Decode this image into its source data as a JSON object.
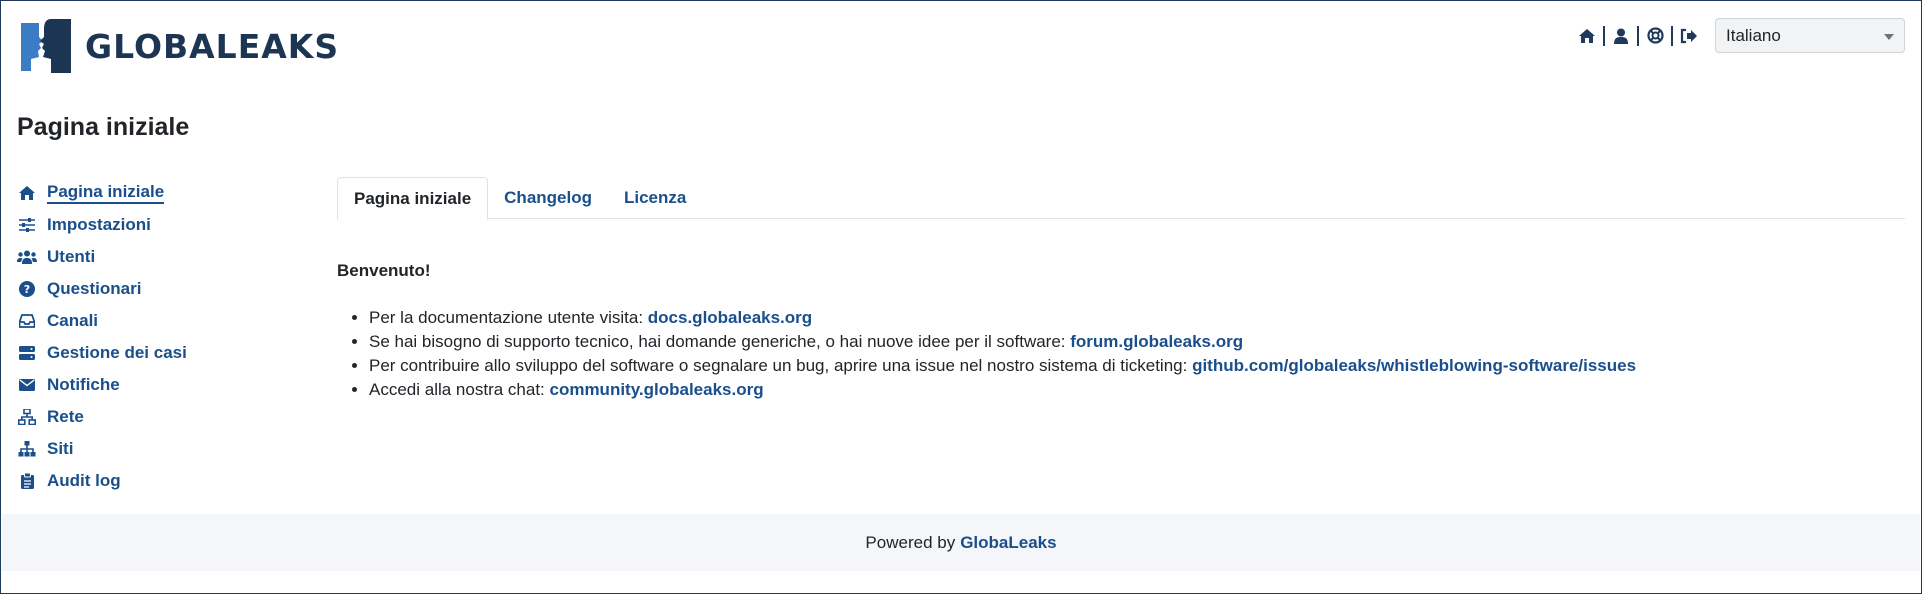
{
  "header": {
    "logo_text": "GLOBALEAKS",
    "icons": [
      "home-icon",
      "user-icon",
      "support-icon",
      "logout-icon"
    ],
    "language": {
      "selected": "Italiano"
    }
  },
  "page": {
    "title": "Pagina iniziale"
  },
  "sidebar": {
    "items": [
      {
        "label": "Pagina iniziale",
        "icon": "home-icon",
        "active": true
      },
      {
        "label": "Impostazioni",
        "icon": "sliders-icon"
      },
      {
        "label": "Utenti",
        "icon": "users-icon"
      },
      {
        "label": "Questionari",
        "icon": "question-icon"
      },
      {
        "label": "Canali",
        "icon": "inbox-icon"
      },
      {
        "label": "Gestione dei casi",
        "icon": "server-icon"
      },
      {
        "label": "Notifiche",
        "icon": "envelope-icon"
      },
      {
        "label": "Rete",
        "icon": "network-icon"
      },
      {
        "label": "Siti",
        "icon": "sitemap-icon"
      },
      {
        "label": "Audit log",
        "icon": "clipboard-icon"
      }
    ]
  },
  "tabs": [
    {
      "label": "Pagina iniziale",
      "active": true
    },
    {
      "label": "Changelog"
    },
    {
      "label": "Licenza"
    }
  ],
  "content": {
    "welcome": "Benvenuto!",
    "items": [
      {
        "text": "Per la documentazione utente visita: ",
        "link": "docs.globaleaks.org"
      },
      {
        "text": "Se hai bisogno di supporto tecnico, hai domande generiche, o hai nuove idee per il software: ",
        "link": "forum.globaleaks.org"
      },
      {
        "text": "Per contribuire allo sviluppo del software o segnalare un bug, aprire una issue nel nostro sistema di ticketing: ",
        "link": "github.com/globaleaks/whistleblowing-software/issues"
      },
      {
        "text": "Accedi alla nostra chat: ",
        "link": "community.globaleaks.org"
      }
    ]
  },
  "footer": {
    "text": "Powered by",
    "brand": "GlobaLeaks"
  },
  "colors": {
    "accent": "#1a4f8b",
    "logo_dark": "#1c3553",
    "logo_light": "#3b7cc4",
    "footer_bg": "#f4f6f9"
  }
}
